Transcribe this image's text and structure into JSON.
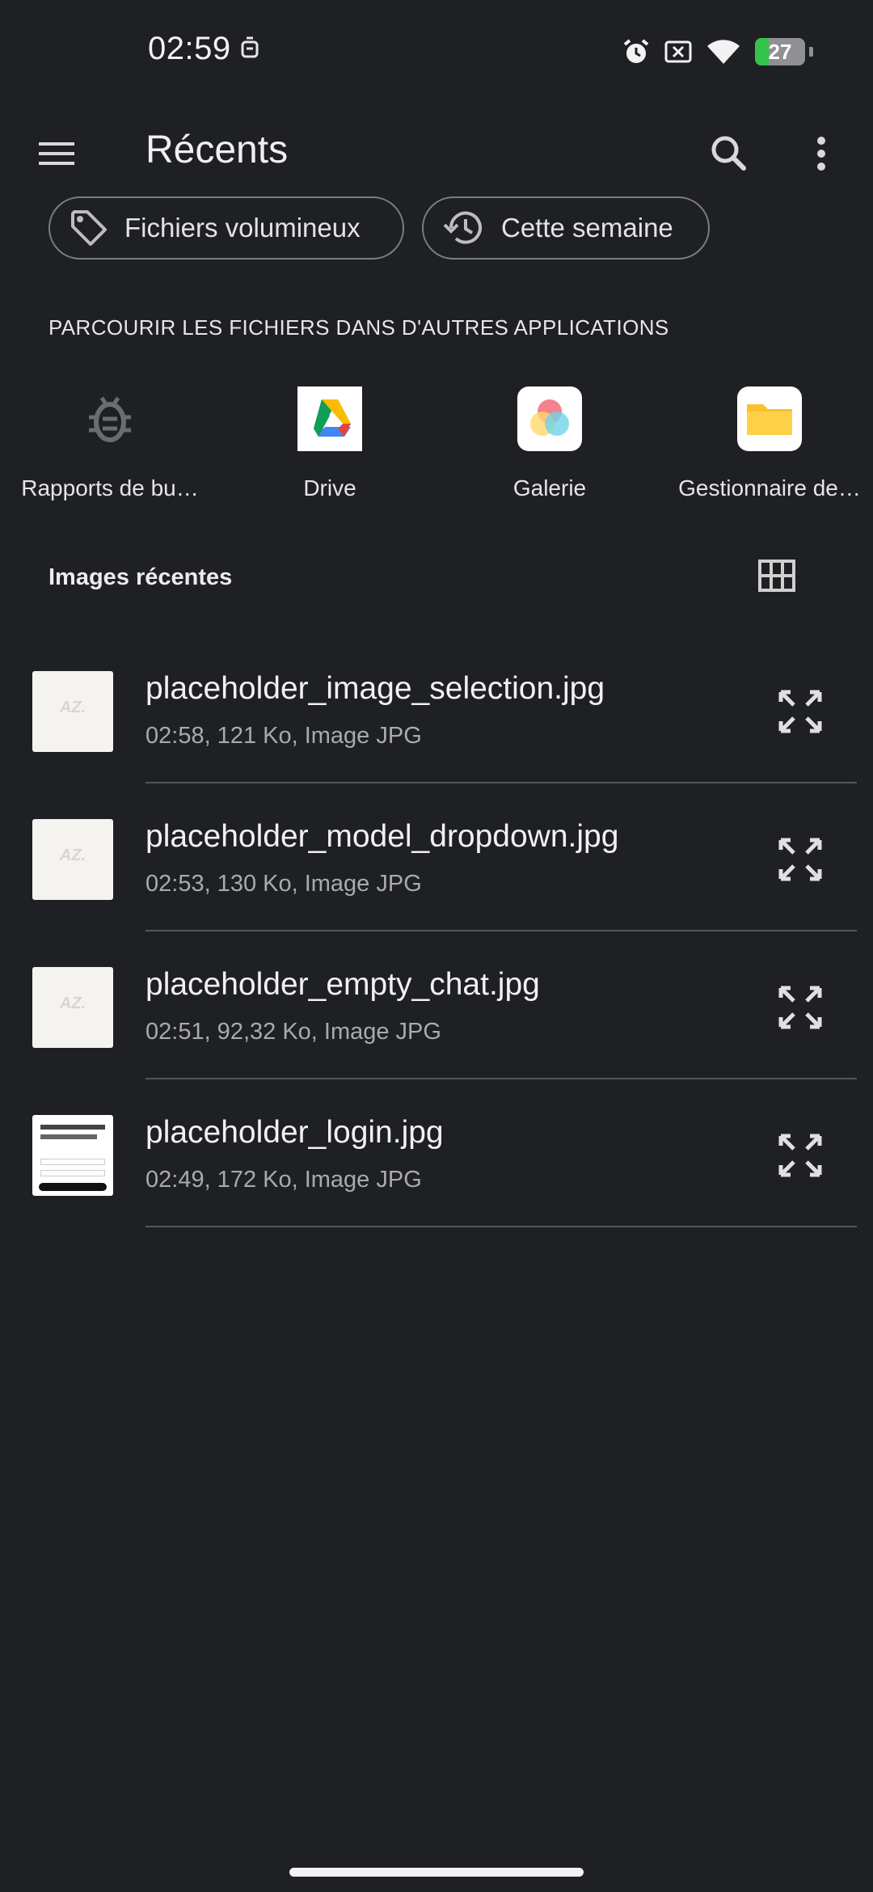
{
  "status": {
    "time": "02:59",
    "battery_text": "27",
    "battery_level": 0.27,
    "icons": [
      "alarm-icon",
      "sim-off-icon",
      "wifi-icon",
      "battery-charging-icon"
    ]
  },
  "app_bar": {
    "title": "Récents",
    "icons": [
      "menu-icon",
      "search-icon",
      "more-vert-icon"
    ]
  },
  "filters": [
    {
      "label": "Fichiers volumineux",
      "icon": "tag-icon"
    },
    {
      "label": "Cette semaine",
      "icon": "history-icon"
    }
  ],
  "browse": {
    "title": "PARCOURIR LES FICHIERS DANS D'AUTRES APPLICATIONS",
    "apps": [
      {
        "label": "Rapports de bu…",
        "icon": "bug-icon"
      },
      {
        "label": "Drive",
        "icon": "google-drive-icon"
      },
      {
        "label": "Galerie",
        "icon": "gallery-icon"
      },
      {
        "label": "Gestionnaire de…",
        "icon": "folder-icon"
      }
    ]
  },
  "recent": {
    "title": "Images récentes",
    "view_icon": "grid-view-icon",
    "files": [
      {
        "name": "placeholder_image_selection.jpg",
        "meta": "02:58, 121 Ko, Image JPG"
      },
      {
        "name": "placeholder_model_dropdown.jpg",
        "meta": "02:53, 130 Ko, Image JPG"
      },
      {
        "name": "placeholder_empty_chat.jpg",
        "meta": "02:51, 92,32 Ko, Image JPG"
      },
      {
        "name": "placeholder_login.jpg",
        "meta": "02:49, 172 Ko, Image JPG"
      }
    ]
  },
  "colors": {
    "background": "#1f2024",
    "battery_green": "#35c24b",
    "folder_yellow": "#fbc02d"
  }
}
